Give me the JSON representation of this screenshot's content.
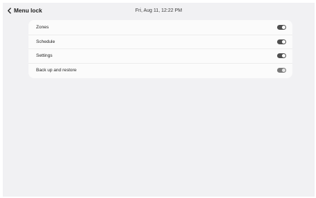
{
  "header": {
    "title": "Menu lock",
    "back_icon": "chevron-left-icon",
    "datetime": "Fri, Aug 11, 12:22 PM"
  },
  "colors": {
    "background": "#f1f1f3",
    "card": "#fbfbfb",
    "toggle_track": "#4f4f4f",
    "toggle_knob": "#ffffff"
  },
  "settings": {
    "items": [
      {
        "label": "Zones",
        "state": "off"
      },
      {
        "label": "Schedule",
        "state": "off"
      },
      {
        "label": "Settings",
        "state": "off"
      },
      {
        "label": "Back up and restore",
        "state": "off-disabled"
      }
    ]
  }
}
